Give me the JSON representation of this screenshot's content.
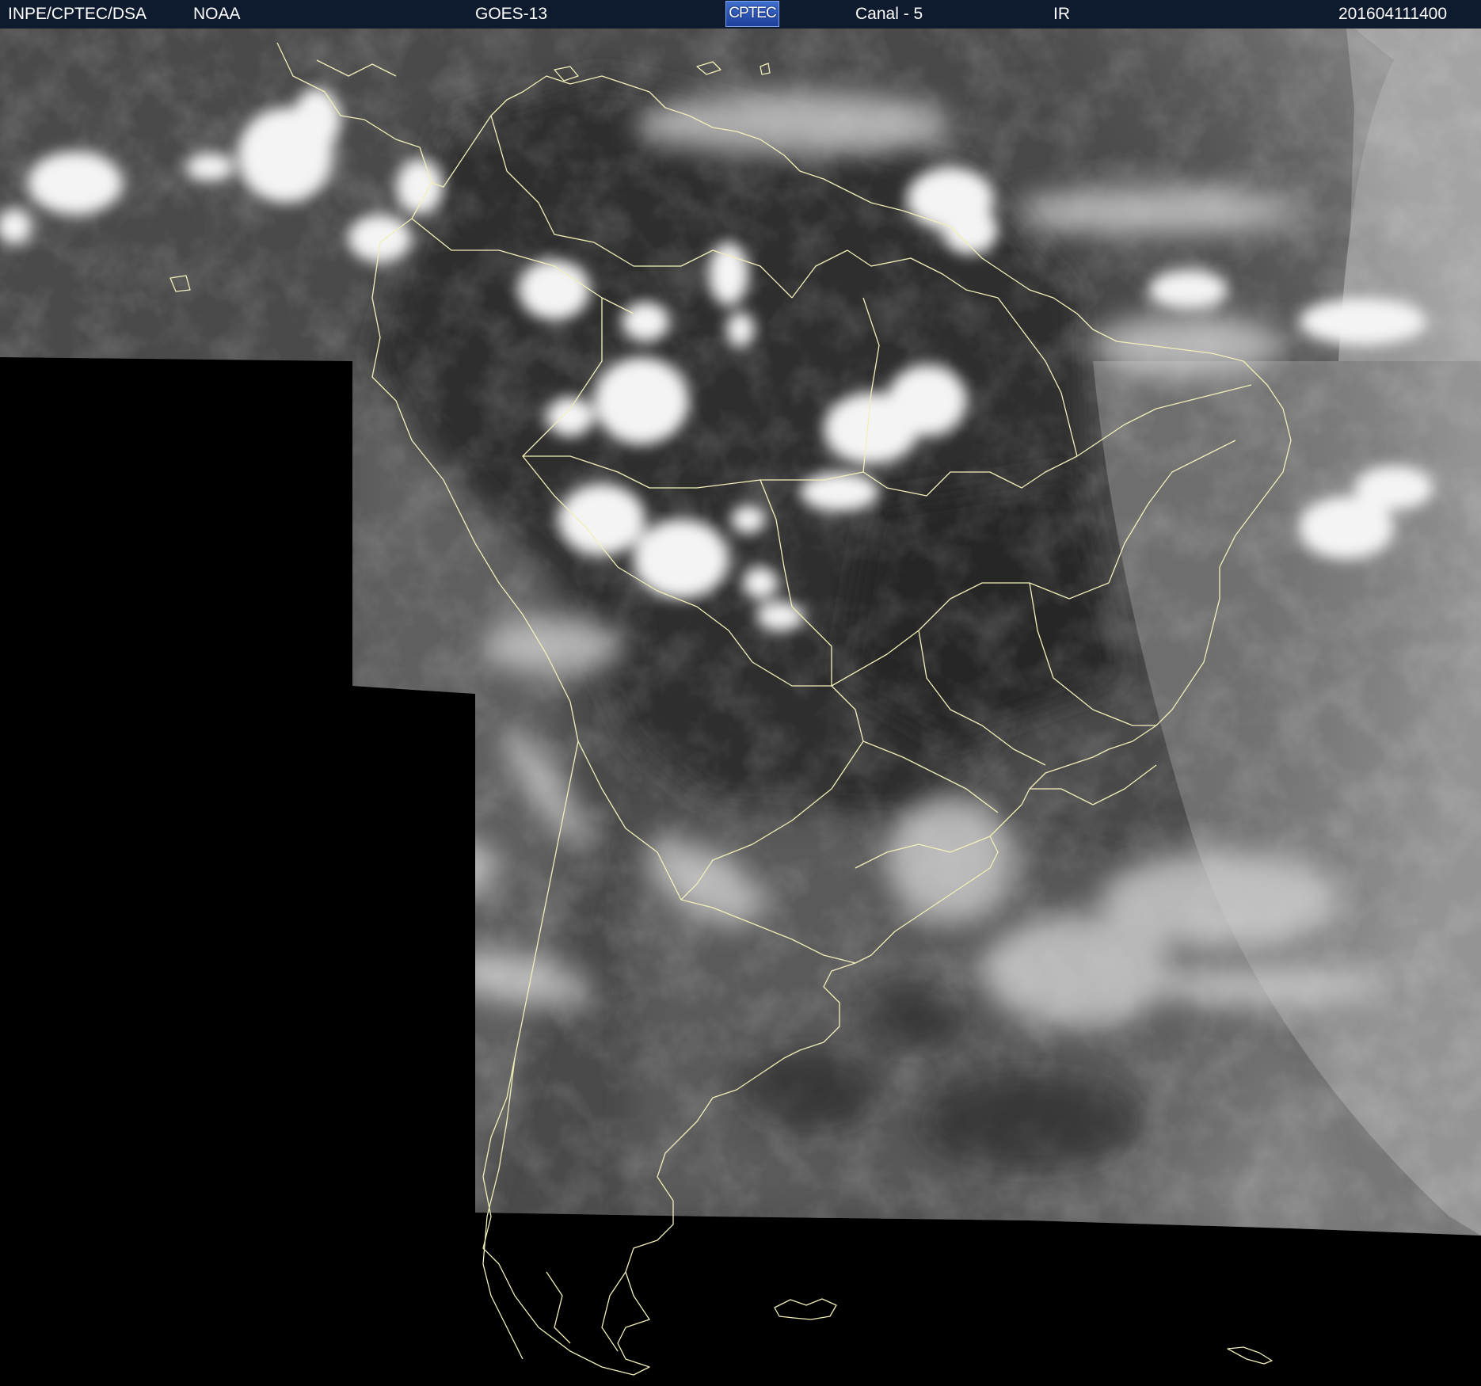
{
  "header": {
    "source": "INPE/CPTEC/DSA",
    "agency": "NOAA",
    "satellite": "GOES-13",
    "logo_text": "CPTEC",
    "channel": "Canal - 5",
    "band": "IR",
    "timestamp": "201604111400"
  },
  "colors": {
    "header_bg": "#0e1a2e",
    "header_text": "#ffffff",
    "coastline": "#f2f0b8",
    "no_data": "#000000",
    "logo_blue": "#2a56c0"
  },
  "icons": {
    "logo": "cptec-logo"
  }
}
